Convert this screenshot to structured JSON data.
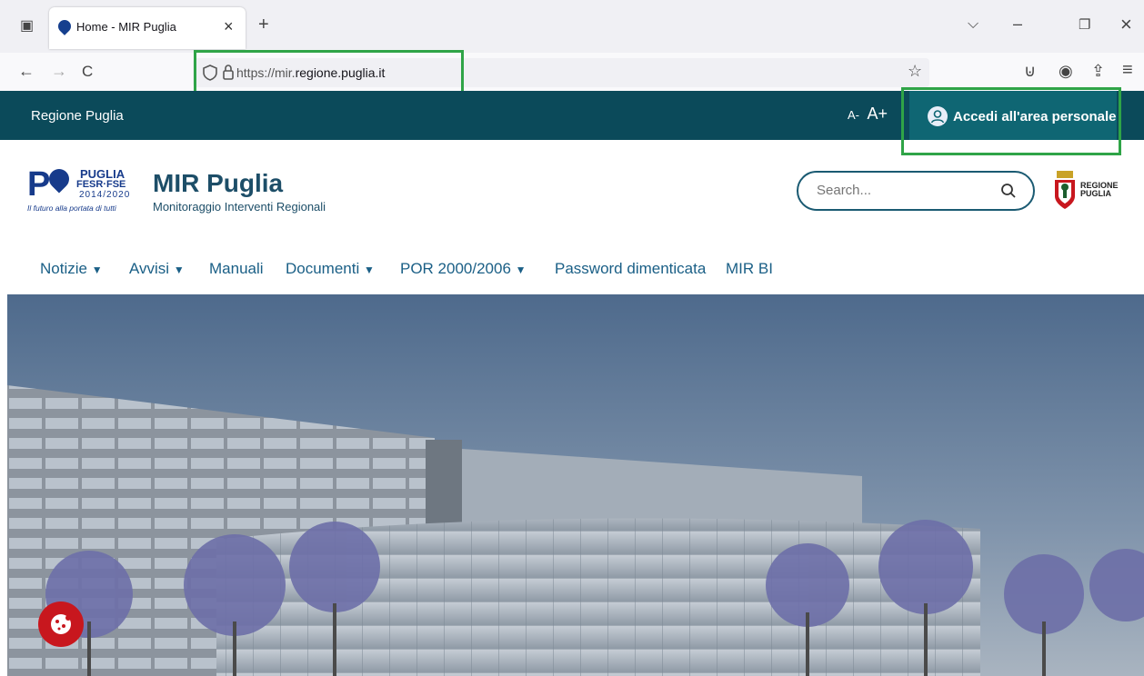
{
  "browser": {
    "tab_title": "Home - MIR Puglia",
    "tab_close": "×",
    "new_tab": "+",
    "tab_list": "⌵",
    "minimize": "–",
    "restore": "❐",
    "close_window": "×",
    "back": "←",
    "forward": "→",
    "reload": "C",
    "url_prefix": "https://mir.",
    "url_domain": "regione.puglia.it",
    "bookmark_star": "☆",
    "pocket": "⊍",
    "account": "◉",
    "extensions": "⇪",
    "menu": "≡"
  },
  "topbar": {
    "region_link": "Regione Puglia",
    "font_decrease": "A-",
    "font_increase": "A+",
    "login_label": "Accedi all'area personale"
  },
  "header": {
    "logo_p": "P",
    "logo_puglia": "PUGLIA",
    "logo_fund": "FESR·FSE",
    "logo_years": "2014/2020",
    "logo_tagline": "Il futuro alla portata di tutti",
    "title": "MIR Puglia",
    "subtitle": "Monitoraggio Interventi Regionali",
    "search_placeholder": "Search...",
    "region_logo_line1": "REGIONE",
    "region_logo_line2": "PUGLIA"
  },
  "menu": {
    "items": [
      {
        "label": "Notizie",
        "dropdown": true
      },
      {
        "label": "Avvisi",
        "dropdown": true
      },
      {
        "label": "Manuali",
        "dropdown": false
      },
      {
        "label": "Documenti",
        "dropdown": true
      },
      {
        "label": "POR 2000/2006",
        "dropdown": true
      },
      {
        "label": "Password dimenticata",
        "dropdown": false
      },
      {
        "label": "MIR BI",
        "dropdown": false
      }
    ],
    "caret": "▼"
  },
  "colors": {
    "topbar": "#0b4a5a",
    "login_button": "#0f6673",
    "accent_text": "#1a5f86",
    "highlight": "#2fa447",
    "cookie": "#c8171e"
  }
}
